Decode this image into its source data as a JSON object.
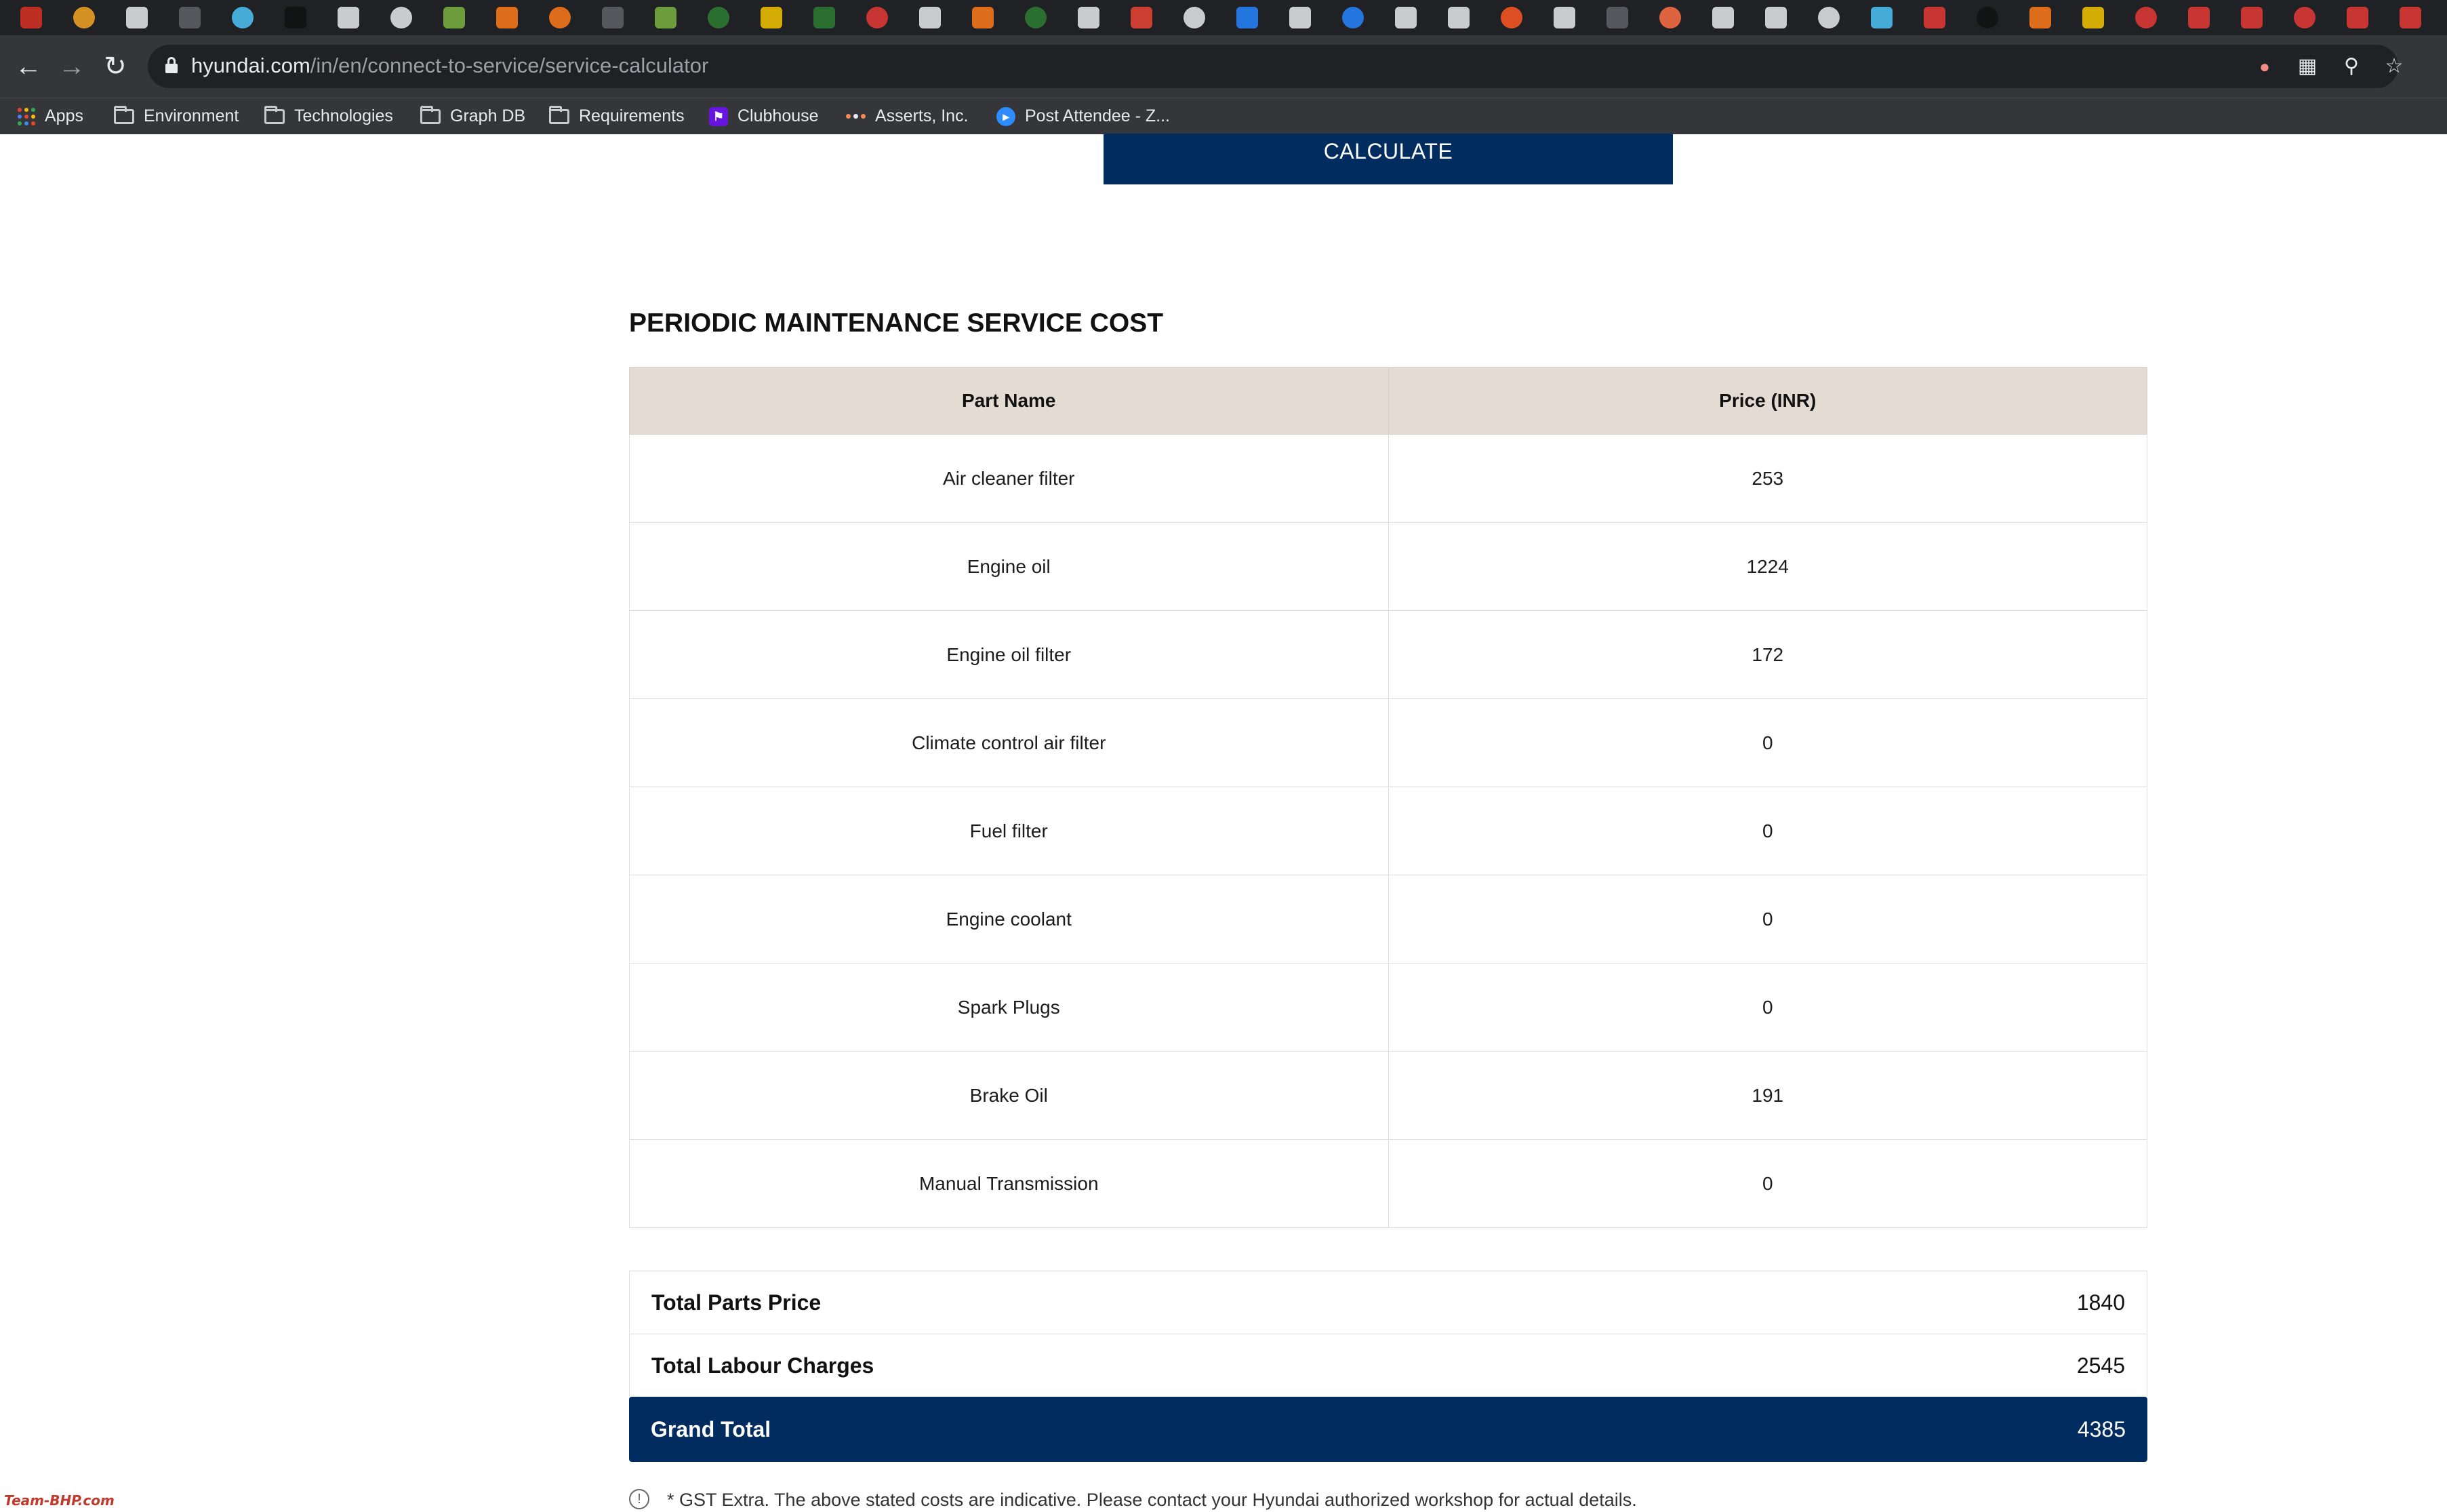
{
  "browser": {
    "url_host": "hyundai.com",
    "url_path": "/in/en/connect-to-service/service-calculator",
    "bookmarks": [
      {
        "label": "Apps",
        "icon": "apps-grid-icon"
      },
      {
        "label": "Environment",
        "icon": "folder-icon"
      },
      {
        "label": "Technologies",
        "icon": "folder-icon"
      },
      {
        "label": "Graph DB",
        "icon": "folder-icon"
      },
      {
        "label": "Requirements",
        "icon": "folder-icon"
      },
      {
        "label": "Clubhouse",
        "icon": "clubhouse-icon"
      },
      {
        "label": "Asserts, Inc.",
        "icon": "dots-icon"
      },
      {
        "label": "Post Attendee - Z...",
        "icon": "zoom-icon"
      }
    ]
  },
  "page": {
    "calculate_label": "CALCULATE",
    "section_title": "PERIODIC MAINTENANCE SERVICE COST",
    "table": {
      "headers": [
        "Part Name",
        "Price (INR)"
      ],
      "rows": [
        {
          "part": "Air cleaner filter",
          "price": "253"
        },
        {
          "part": "Engine oil",
          "price": "1224"
        },
        {
          "part": "Engine oil filter",
          "price": "172"
        },
        {
          "part": "Climate control air filter",
          "price": "0"
        },
        {
          "part": "Fuel filter",
          "price": "0"
        },
        {
          "part": "Engine coolant",
          "price": "0"
        },
        {
          "part": "Spark Plugs",
          "price": "0"
        },
        {
          "part": "Brake Oil",
          "price": "191"
        },
        {
          "part": "Manual Transmission",
          "price": "0"
        }
      ]
    },
    "totals": {
      "parts_label": "Total Parts Price",
      "parts_value": "1840",
      "labour_label": "Total Labour Charges",
      "labour_value": "2545",
      "grand_label": "Grand Total",
      "grand_value": "4385"
    },
    "disclaimer": "* GST Extra. The above stated costs are indicative. Please contact your Hyundai authorized workshop for actual details.",
    "colors": {
      "brand_navy": "#002c5f",
      "table_header": "#e4dcd3"
    }
  }
}
